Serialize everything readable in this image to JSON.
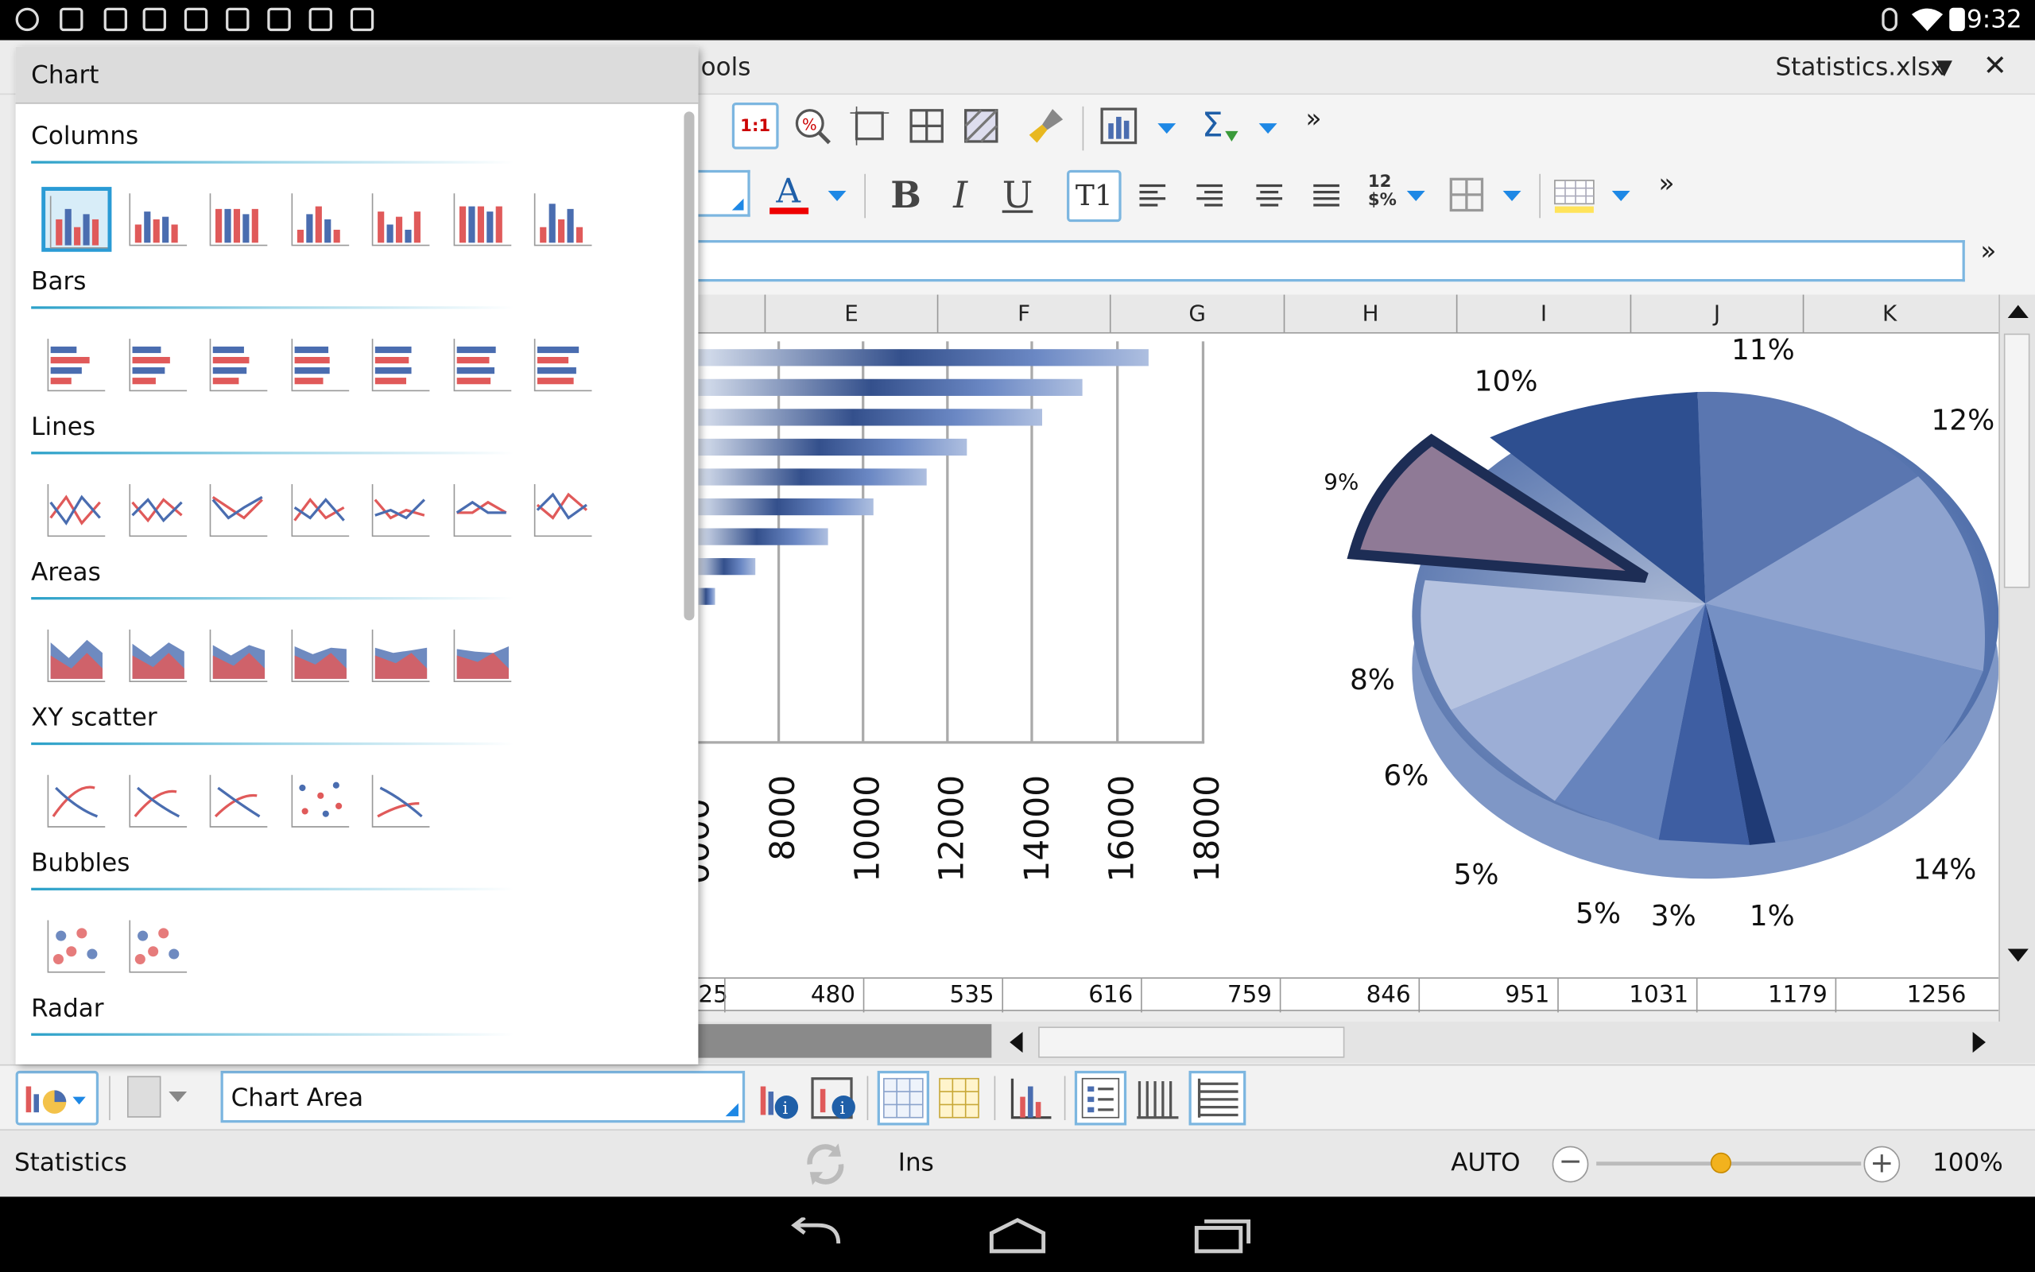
{
  "app": {
    "file_name": "Statistics.xlsx",
    "menu_partial": "ools",
    "dropdown_glyph": "▼",
    "close_glyph": "✕"
  },
  "status_bar": {
    "time": "9:32"
  },
  "toolbar": {
    "overflow_glyph": "»",
    "actual_size_label": "1:1",
    "number_format_label": "12\n$%"
  },
  "columns": [
    "E",
    "F",
    "G",
    "H",
    "I",
    "J",
    "K"
  ],
  "data_row": [
    "25",
    "480",
    "535",
    "616",
    "759",
    "846",
    "951",
    "1031",
    "1179",
    "1256"
  ],
  "bar_chart": {
    "axis_ticks": [
      "8000",
      "10000",
      "12000",
      "14000",
      "16000",
      "18000"
    ]
  },
  "pie_chart": {
    "labels": [
      "11%",
      "12%",
      "14%",
      "1%",
      "3%",
      "5%",
      "5%",
      "6%",
      "8%",
      "9%",
      "10%"
    ]
  },
  "chart_panel": {
    "title": "Chart",
    "sections": [
      {
        "name": "Columns",
        "count": 7
      },
      {
        "name": "Bars",
        "count": 7
      },
      {
        "name": "Lines",
        "count": 7
      },
      {
        "name": "Areas",
        "count": 6
      },
      {
        "name": "XY scatter",
        "count": 5
      },
      {
        "name": "Bubbles",
        "count": 2
      },
      {
        "name": "Radar",
        "count": 0
      }
    ]
  },
  "bottom_bar": {
    "element_select_value": "Chart Area"
  },
  "status_line": {
    "sheet_name": "Statistics",
    "insert_mode": "Ins",
    "calc_mode": "AUTO",
    "zoom": "100%",
    "zoom_fraction": 0.47
  },
  "colors": {
    "accent": "#2a9bd5",
    "chart_red": "#e05a5a",
    "chart_blue": "#4a6db0"
  }
}
